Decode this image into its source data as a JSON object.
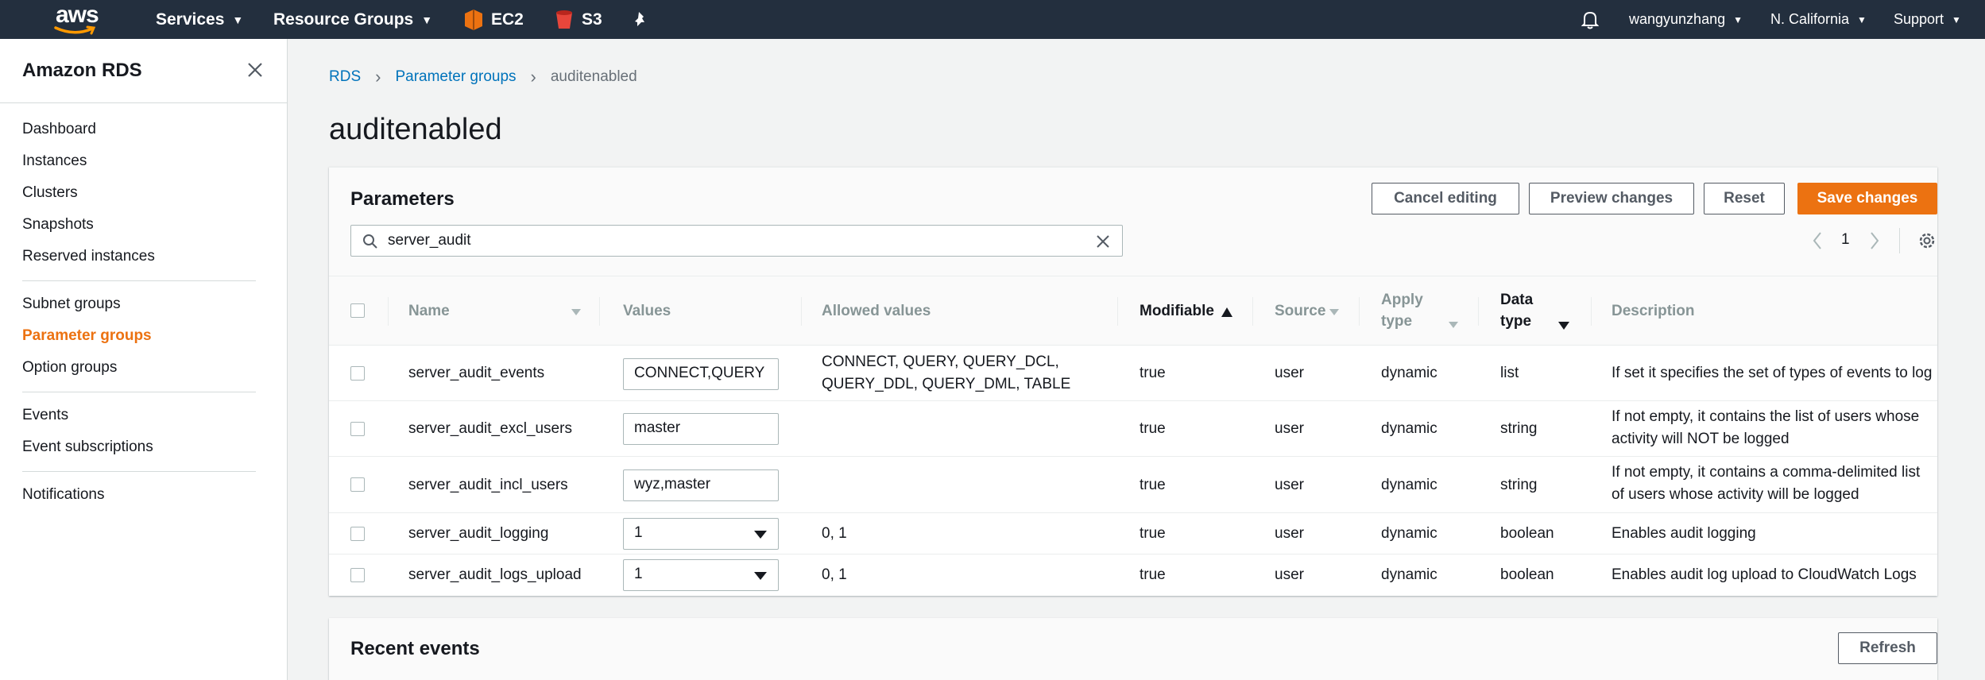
{
  "topnav": {
    "logo": "aws",
    "services": "Services",
    "resource_groups": "Resource Groups",
    "ec2": "EC2",
    "s3": "S3",
    "user": "wangyunzhang",
    "region": "N. California",
    "support": "Support",
    "colors": {
      "bg": "#232f3e",
      "ec2_icon": "#ec7211",
      "s3_icon": "#e7463b"
    }
  },
  "sidebar": {
    "title": "Amazon RDS",
    "items": [
      {
        "label": "Dashboard"
      },
      {
        "label": "Instances"
      },
      {
        "label": "Clusters"
      },
      {
        "label": "Snapshots"
      },
      {
        "label": "Reserved instances"
      },
      {
        "label": "Subnet groups"
      },
      {
        "label": "Parameter groups",
        "active": true
      },
      {
        "label": "Option groups"
      },
      {
        "label": "Events"
      },
      {
        "label": "Event subscriptions"
      },
      {
        "label": "Notifications"
      }
    ]
  },
  "breadcrumb": {
    "rds": "RDS",
    "parameter_groups": "Parameter groups",
    "current": "auditenabled"
  },
  "page_title": "auditenabled",
  "parameters": {
    "title": "Parameters",
    "buttons": {
      "cancel": "Cancel editing",
      "preview": "Preview changes",
      "reset": "Reset",
      "save": "Save changes"
    },
    "search_value": "server_audit",
    "page": "1",
    "columns": {
      "name": "Name",
      "values": "Values",
      "allowed": "Allowed values",
      "modifiable": "Modifiable",
      "source": "Source",
      "apply_line1": "Apply",
      "apply_line2": "type",
      "data_line1": "Data",
      "data_line2": "type",
      "description": "Description"
    },
    "rows": [
      {
        "name": "server_audit_events",
        "value": "CONNECT,QUERY",
        "allowed_line1": "CONNECT, QUERY, QUERY_DCL,",
        "allowed_line2": "QUERY_DDL, QUERY_DML, TABLE",
        "modifiable": "true",
        "source": "user",
        "apply_type": "dynamic",
        "data_type": "list",
        "desc_line1": "If set it specifies the set of types of events to log",
        "desc_line2": ""
      },
      {
        "name": "server_audit_excl_users",
        "value": "master",
        "allowed_line1": "",
        "allowed_line2": "",
        "modifiable": "true",
        "source": "user",
        "apply_type": "dynamic",
        "data_type": "string",
        "desc_line1": "If not empty, it contains the list of users whose",
        "desc_line2": "activity will NOT be logged"
      },
      {
        "name": "server_audit_incl_users",
        "value": "wyz,master",
        "allowed_line1": "",
        "allowed_line2": "",
        "modifiable": "true",
        "source": "user",
        "apply_type": "dynamic",
        "data_type": "string",
        "desc_line1": "If not empty, it contains a comma-delimited list",
        "desc_line2": "of users whose activity will be logged"
      },
      {
        "name": "server_audit_logging",
        "value": "1",
        "allowed_line1": "0, 1",
        "allowed_line2": "",
        "modifiable": "true",
        "source": "user",
        "apply_type": "dynamic",
        "data_type": "boolean",
        "desc_line1": "Enables audit logging",
        "desc_line2": ""
      },
      {
        "name": "server_audit_logs_upload",
        "value": "1",
        "allowed_line1": "0, 1",
        "allowed_line2": "",
        "modifiable": "true",
        "source": "user",
        "apply_type": "dynamic",
        "data_type": "boolean",
        "desc_line1": "Enables audit log upload to CloudWatch Logs",
        "desc_line2": ""
      }
    ]
  },
  "recent_events": {
    "title": "Recent events",
    "refresh": "Refresh"
  }
}
